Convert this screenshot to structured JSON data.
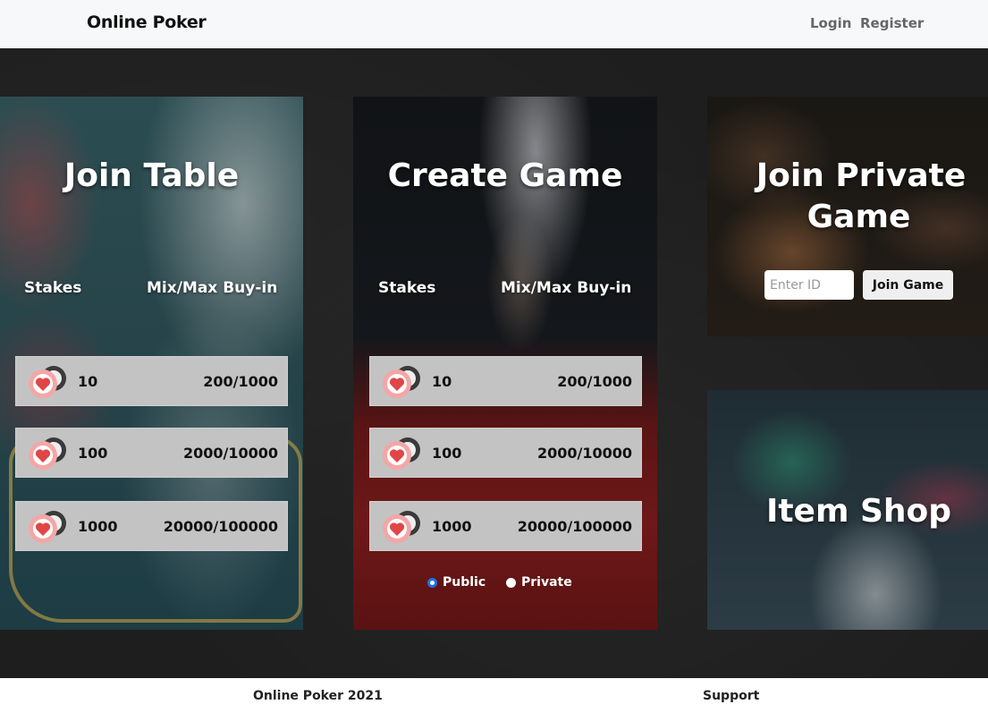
{
  "nav": {
    "brand": "Online Poker",
    "login": "Login",
    "register": "Register"
  },
  "join_table": {
    "title": "Join Table",
    "col_stakes": "Stakes",
    "col_buyin": "Mix/Max Buy-in",
    "rows": [
      {
        "stake": "10",
        "buyin": "200/1000"
      },
      {
        "stake": "100",
        "buyin": "2000/10000"
      },
      {
        "stake": "1000",
        "buyin": "20000/100000"
      }
    ]
  },
  "create_game": {
    "title": "Create Game",
    "col_stakes": "Stakes",
    "col_buyin": "Mix/Max Buy-in",
    "rows": [
      {
        "stake": "10",
        "buyin": "200/1000"
      },
      {
        "stake": "100",
        "buyin": "2000/10000"
      },
      {
        "stake": "1000",
        "buyin": "20000/100000"
      }
    ],
    "visibility": {
      "public_label": "Public",
      "private_label": "Private",
      "selected": "Public"
    }
  },
  "join_private": {
    "title_line1": "Join Private",
    "title_line2": "Game",
    "input_placeholder": "Enter ID",
    "button_label": "Join Game"
  },
  "item_shop": {
    "title": "Item Shop"
  },
  "footer": {
    "copyright": "Online Poker 2021",
    "support": "Support"
  },
  "colors": {
    "navbar_bg": "#f7f8fa",
    "page_bg": "#1e1e1e",
    "row_bg": "#c3c3c3",
    "radio_accent": "#1a73e8"
  },
  "icons": {
    "chip": "poker-chips-icon"
  }
}
